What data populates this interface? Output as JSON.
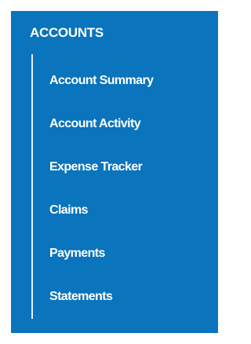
{
  "sidebar": {
    "title": "ACCOUNTS",
    "colors": {
      "background": "#0a74bd",
      "text": "#ffffff",
      "rail": "#e6eef6"
    },
    "items": [
      {
        "label": "Account Summary"
      },
      {
        "label": "Account Activity"
      },
      {
        "label": "Expense Tracker"
      },
      {
        "label": "Claims"
      },
      {
        "label": "Payments"
      },
      {
        "label": "Statements"
      }
    ]
  }
}
